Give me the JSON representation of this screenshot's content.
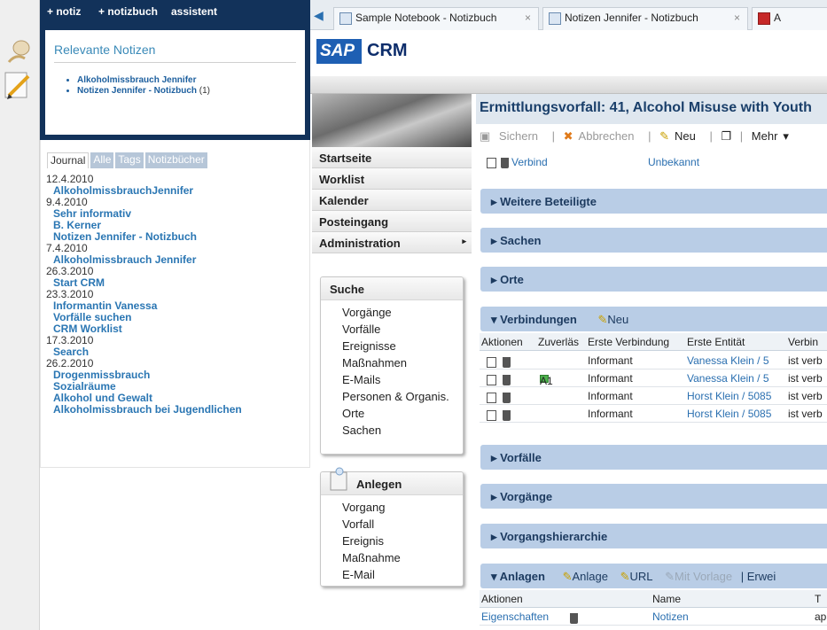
{
  "notiz_bar": {
    "items": [
      "+ notiz",
      "+ notizbuch",
      "assistent"
    ]
  },
  "relevant": {
    "title": "Relevante Notizen",
    "items": [
      {
        "label": "Alkoholmissbrauch Jennifer",
        "count": ""
      },
      {
        "label": "Notizen Jennifer - Notizbuch",
        "count": "(1)"
      }
    ]
  },
  "journal": {
    "tabs": [
      "Journal",
      "Alle",
      "Tags",
      "Notizbücher"
    ],
    "entries": [
      {
        "date": "12.4.2010",
        "items": [
          "AlkoholmissbrauchJennifer"
        ]
      },
      {
        "date": "9.4.2010",
        "items": [
          "Sehr informativ",
          "B. Kerner",
          "Notizen Jennifer - Notizbuch"
        ]
      },
      {
        "date": "7.4.2010",
        "items": [
          "Alkoholmissbrauch Jennifer"
        ]
      },
      {
        "date": "26.3.2010",
        "items": [
          "Start CRM"
        ]
      },
      {
        "date": "23.3.2010",
        "items": [
          "Informantin Vanessa",
          "Vorfälle suchen",
          "CRM Worklist"
        ]
      },
      {
        "date": "17.3.2010",
        "items": [
          "Search"
        ]
      },
      {
        "date": "26.2.2010",
        "items": [
          "Drogenmissbrauch",
          "Sozialräume",
          "Alkohol und Gewalt",
          "Alkoholmissbrauch bei Jugendlichen"
        ]
      }
    ]
  },
  "browser_tabs": [
    {
      "label": "Sample Notebook - Notizbuch",
      "close": "×"
    },
    {
      "label": "Notizen Jennifer - Notizbuch",
      "close": "×"
    },
    {
      "label": "A",
      "close": ""
    }
  ],
  "header": {
    "logo": "SAP",
    "product": "CRM"
  },
  "nav": {
    "items": [
      "Startseite",
      "Worklist",
      "Kalender",
      "Posteingang",
      "Administration"
    ],
    "admin_arrow": "▸"
  },
  "search_box": {
    "title": "Suche",
    "items": [
      "Vorgänge",
      "Vorfälle",
      "Ereignisse",
      "Maßnahmen",
      "E-Mails",
      "Personen & Organis.",
      "Orte",
      "Sachen"
    ]
  },
  "create_box": {
    "title": "Anlegen",
    "items": [
      "Vorgang",
      "Vorfall",
      "Ereignis",
      "Maßnahme",
      "E-Mail"
    ]
  },
  "main": {
    "title": "Ermittlungsvorfall: 41, Alcohol Misuse with Youth",
    "toolbar": {
      "save": "Sichern",
      "cancel": "Abbrechen",
      "new": "Neu",
      "more": "Mehr"
    },
    "verbind_row": {
      "link": "Verbind",
      "value": "Unbekannt"
    },
    "sections": [
      "Weitere Beteiligte",
      "Sachen",
      "Orte"
    ],
    "connections": {
      "title": "Verbindungen",
      "new_label": "Neu",
      "columns": [
        "Aktionen",
        "Zuverläs",
        "Erste Verbindung",
        "Erste Entität",
        "Verbin"
      ],
      "rows": [
        {
          "zuv": "",
          "first": "Informant",
          "entity": "Vanessa Klein / 5",
          "verb": "ist verb"
        },
        {
          "zuv": "A1",
          "first": "Informant",
          "entity": "Vanessa Klein / 5",
          "verb": "ist verb"
        },
        {
          "zuv": "",
          "first": "Informant",
          "entity": "Horst Klein / 5085",
          "verb": "ist verb"
        },
        {
          "zuv": "",
          "first": "Informant",
          "entity": "Horst Klein / 5085",
          "verb": "ist verb"
        }
      ]
    },
    "sections2": [
      "Vorfälle",
      "Vorgänge",
      "Vorgangshierarchie"
    ],
    "attachments": {
      "title": "Anlagen",
      "buttons": [
        "Anlage",
        "URL",
        "Mit Vorlage",
        "Erwei"
      ],
      "columns": [
        "Aktionen",
        "Name",
        "T"
      ],
      "row": {
        "action": "Eigenschaften",
        "name": "Notizen",
        "type": "ap"
      }
    }
  }
}
